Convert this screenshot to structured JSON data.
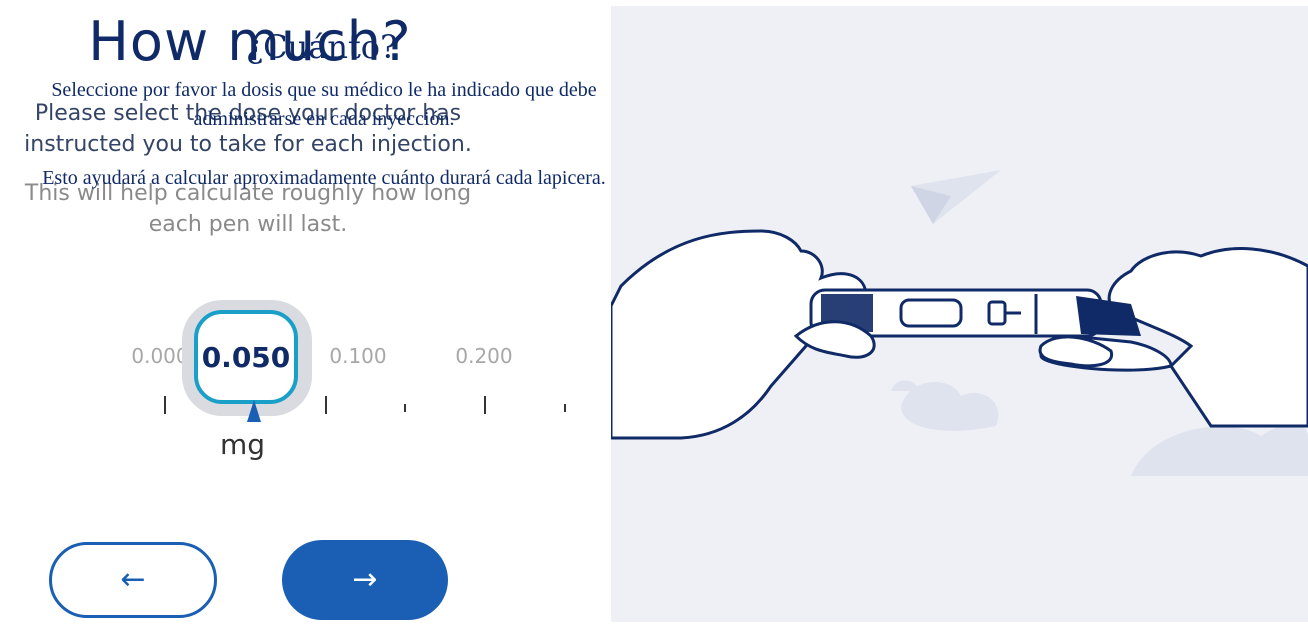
{
  "header": {
    "title_en": "How much?",
    "title_es": "¿Cuánto?"
  },
  "instructions": {
    "subtitle_en": "Please select the dose your doctor has instructed you to take for each injection.",
    "help_en": "This will help calculate roughly how long each pen will last.",
    "subtitle_es": "Seleccione por favor la dosis que su médico le ha indicado que debe administrarse en cada inyección.",
    "help_es": "Esto ayudará a calcular aproximadamente cuánto durará cada lapicera."
  },
  "dose_picker": {
    "options": [
      "0.000",
      "0.050",
      "0.100",
      "0.200"
    ],
    "selected": "0.050",
    "unit": "mg"
  },
  "navigation": {
    "back_icon": "arrow-left-icon",
    "next_icon": "arrow-right-icon",
    "back_symbol": "←",
    "next_symbol": "→"
  },
  "colors": {
    "brand_navy": "#0f2a66",
    "primary_blue": "#1a5fb4",
    "selector_teal": "#1aa0c8",
    "illustration_bg": "#eef0f6"
  },
  "illustration": {
    "icon": "pen-injector-illustration"
  }
}
